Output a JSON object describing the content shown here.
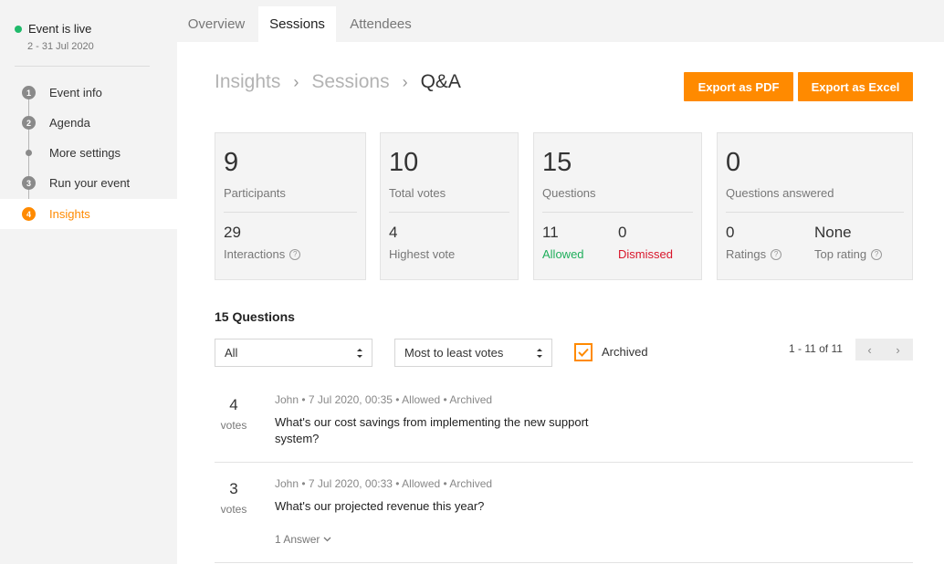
{
  "event": {
    "status": "Event is live",
    "dates": "2 - 31 Jul 2020"
  },
  "sidebar": {
    "steps": [
      {
        "num": "1",
        "label": "Event info"
      },
      {
        "num": "2",
        "label": "Agenda"
      },
      {
        "num": "",
        "label": "More settings"
      },
      {
        "num": "3",
        "label": "Run your event"
      },
      {
        "num": "4",
        "label": "Insights"
      }
    ]
  },
  "tabs": [
    "Overview",
    "Sessions",
    "Attendees"
  ],
  "breadcrumb": {
    "items": [
      "Insights",
      "Sessions"
    ],
    "current": "Q&A",
    "sep": "›"
  },
  "actions": {
    "pdf": "Export as PDF",
    "excel": "Export as Excel"
  },
  "stats": {
    "participants": {
      "value": "9",
      "label": "Participants",
      "sub_value": "29",
      "sub_label": "Interactions"
    },
    "votes": {
      "value": "10",
      "label": "Total votes",
      "sub_value": "4",
      "sub_label": "Highest vote"
    },
    "questions": {
      "value": "15",
      "label": "Questions",
      "allowed_value": "11",
      "allowed_label": "Allowed",
      "dismissed_value": "0",
      "dismissed_label": "Dismissed"
    },
    "answered": {
      "value": "0",
      "label": "Questions answered",
      "ratings_value": "0",
      "ratings_label": "Ratings",
      "top_value": "None",
      "top_label": "Top rating"
    }
  },
  "questions_section": {
    "title": "15 Questions",
    "filter": "All",
    "sort": "Most to least votes",
    "archived_label": "Archived",
    "pagination": "1 - 11 of 11"
  },
  "questions": [
    {
      "votes": "4",
      "votes_label": "votes",
      "meta": "John • 7 Jul 2020, 00:35 • Allowed • Archived",
      "text": "What's our cost savings from implementing the new support system?"
    },
    {
      "votes": "3",
      "votes_label": "votes",
      "meta": "John • 7 Jul 2020, 00:33 • Allowed • Archived",
      "text": "What's our projected revenue this year?",
      "answers": "1 Answer"
    }
  ],
  "colors": {
    "accent": "#ff8a00",
    "live": "#1fba6a",
    "allowed": "#1fae5b",
    "dismissed": "#d8152a"
  }
}
